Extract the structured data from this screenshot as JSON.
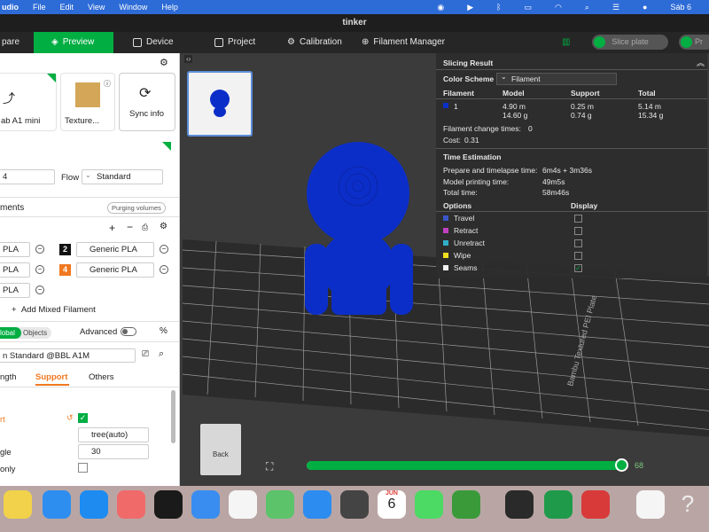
{
  "menubar": {
    "app_name": "udio",
    "items": [
      "File",
      "Edit",
      "View",
      "Window",
      "Help"
    ],
    "clock": "Sáb 6"
  },
  "window": {
    "title": "tinker"
  },
  "toolbar": {
    "prepare": "pare",
    "preview": "Preview",
    "device": "Device",
    "project": "Project",
    "calibration": "Calibration",
    "filament_manager": "Filament Manager",
    "slice_plate": "Slice plate",
    "print": "Pr"
  },
  "left": {
    "printer_name": "ab A1 mini",
    "texture_label": "Texture...",
    "sync_info": "Sync info",
    "nozzle_value": "4",
    "flow_label": "Flow",
    "flow_value": "Standard",
    "filaments_title": "ments",
    "purging_volumes": "Purging volumes",
    "filament_rows": [
      {
        "left": "PLA",
        "num": "2",
        "right": "Generic PLA",
        "color": "#111111"
      },
      {
        "left": "PLA",
        "num": "4",
        "right": "Generic PLA",
        "color": "#f07820"
      },
      {
        "left": "PLA"
      }
    ],
    "add_mixed": "Add Mixed Filament",
    "tab_global": "lobal",
    "tab_objects": "Objects",
    "advanced": "Advanced",
    "process_profile": "n Standard @BBL A1M",
    "tab_strength": "ngth",
    "tab_support": "Support",
    "tab_others": "Others",
    "support_label": "rt",
    "support_type": "tree(auto)",
    "angle_label": "gle",
    "angle_value": "30",
    "only_label": " only"
  },
  "slicing": {
    "title": "Slicing Result",
    "color_scheme_label": "Color Scheme",
    "color_scheme_value": "Filament",
    "headers": [
      "Filament",
      "Model",
      "Support",
      "Total"
    ],
    "row": {
      "filament": "1",
      "model_m": "4.90 m",
      "model_g": "14.60 g",
      "support_m": "0.25 m",
      "support_g": "0.74 g",
      "total_m": "5.14 m",
      "total_g": "15.34 g"
    },
    "change_times_label": "Filament change times:",
    "change_times_value": "0",
    "cost_label": "Cost:",
    "cost_value": "0.31",
    "time_title": "Time Estimation",
    "prepare_label": "Prepare and timelapse time:",
    "prepare_value": "6m4s + 3m36s",
    "model_time_label": "Model printing time:",
    "model_time_value": "49m5s",
    "total_time_label": "Total time:",
    "total_time_value": "58m46s",
    "options_label": "Options",
    "display_label": "Display",
    "options": [
      {
        "label": "Travel",
        "color": "#3a55c8"
      },
      {
        "label": "Retract",
        "color": "#c040c0"
      },
      {
        "label": "Unretract",
        "color": "#30b0c8"
      },
      {
        "label": "Wipe",
        "color": "#f0e020"
      },
      {
        "label": "Seams",
        "color": "#f0f0f0"
      }
    ]
  },
  "viewport": {
    "plate_label": "Bambu Textured PEI Plate",
    "back_label": "Back",
    "layer_value": "68",
    "model_color": "#0c2ec8"
  },
  "dock": {
    "calendar_month": "JUN",
    "calendar_day": "6"
  }
}
